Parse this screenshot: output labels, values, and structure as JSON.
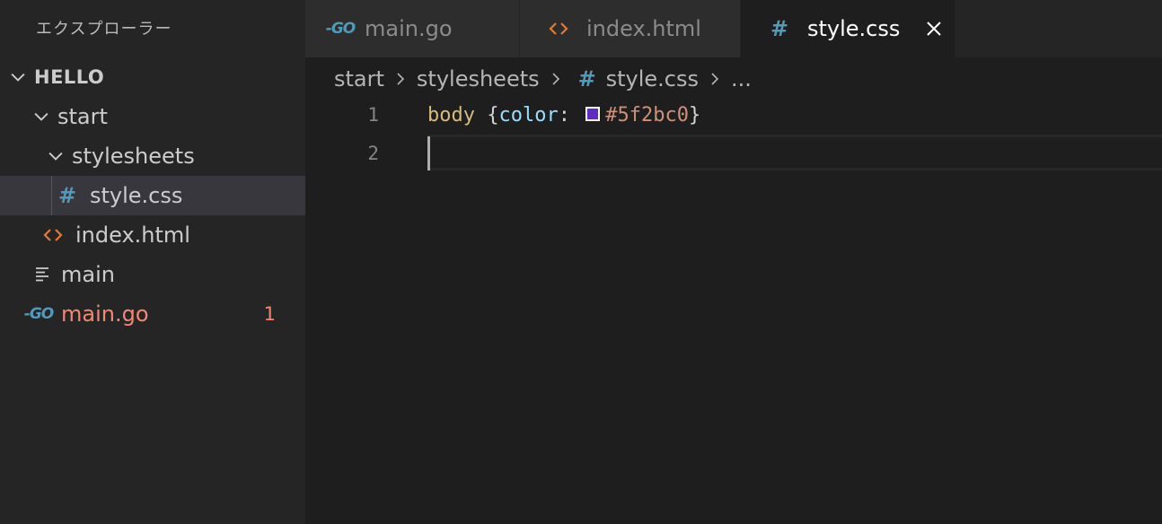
{
  "sidebar": {
    "title": "エクスプローラー",
    "tree": {
      "root": "HELLO",
      "start": "start",
      "stylesheets": "stylesheets",
      "style_css": "style.css",
      "index_html": "index.html",
      "main": "main",
      "main_go": "main.go",
      "main_go_problems": "1"
    }
  },
  "tabs": [
    {
      "label": "main.go",
      "icon": "go-icon",
      "active": false
    },
    {
      "label": "index.html",
      "icon": "html-icon",
      "active": false
    },
    {
      "label": "style.css",
      "icon": "hash-icon",
      "active": true
    }
  ],
  "breadcrumb": {
    "items": [
      "start",
      "stylesheets",
      "style.css",
      "..."
    ]
  },
  "editor": {
    "lines": [
      {
        "number": "1",
        "selector": "body",
        "open": " {",
        "property": "color",
        "colon": ": ",
        "value": "#5f2bc0",
        "close": "}"
      },
      {
        "number": "2"
      }
    ],
    "swatch_color": "#5f2bc0"
  },
  "colors": {
    "sidebar_bg": "#252526",
    "editor_bg": "#1e1e1e",
    "selection_bg": "#37373d",
    "css_icon": "#519aba",
    "html_icon": "#e37933",
    "error": "#f48771"
  }
}
